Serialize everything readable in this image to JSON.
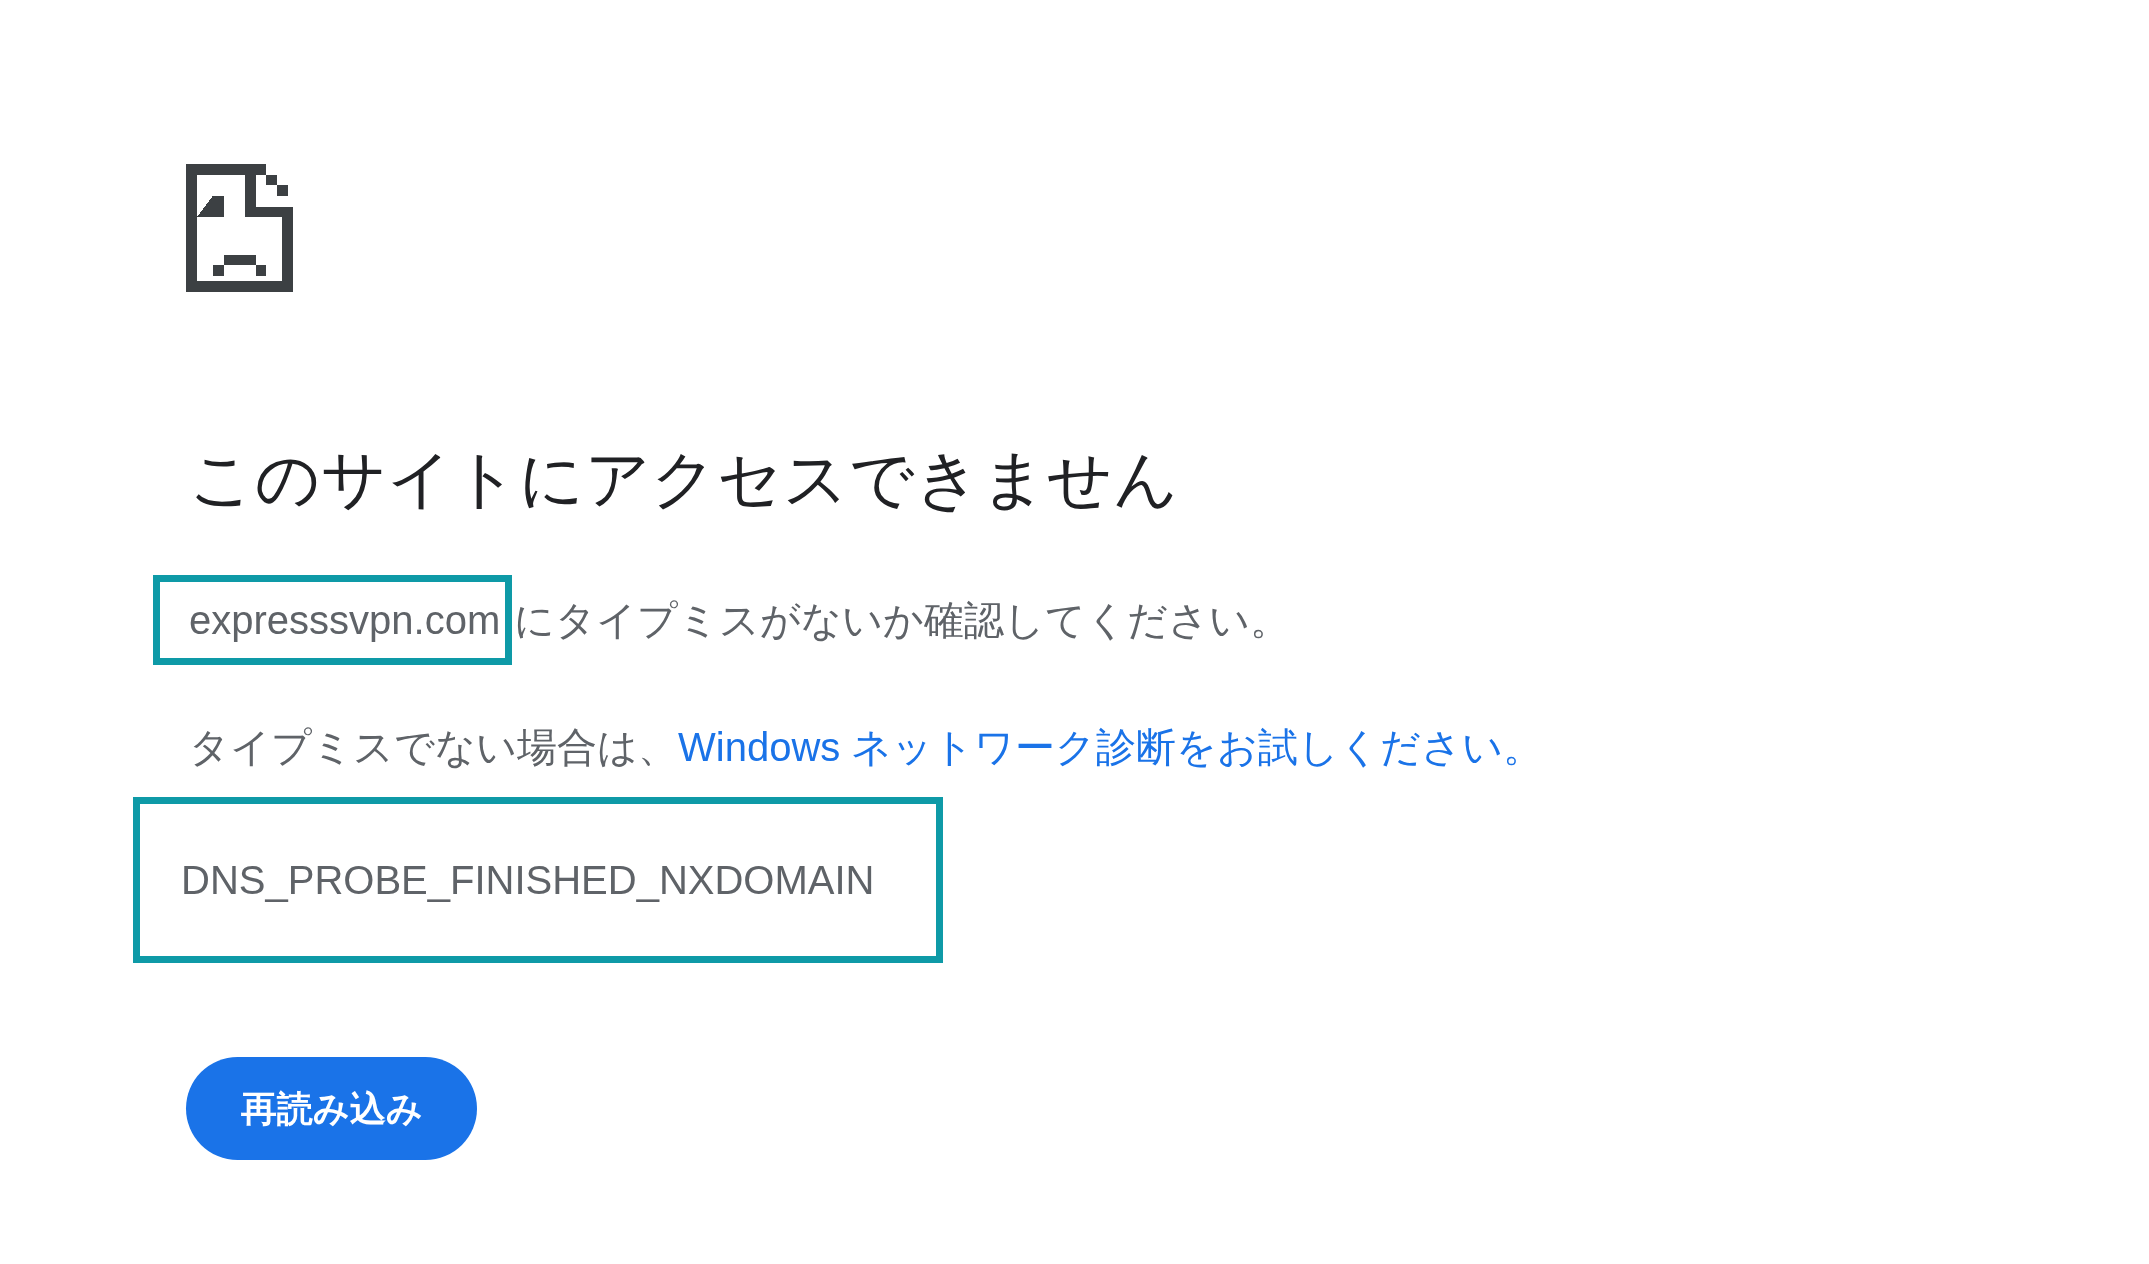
{
  "heading": "このサイトにアクセスできません",
  "check_line": {
    "domain": "expresssvpn.com",
    "domain_highlighted": true,
    "text": "にタイプミスがないか確認してください。"
  },
  "suggestion": {
    "text": "タイプミスでない場合は、",
    "link": "Windows ネットワーク診断をお試しください。"
  },
  "error_code": {
    "text": "DNS_PROBE_FINISHED_NXDOMAIN",
    "highlighted": true
  },
  "reload_button": "再読み込み"
}
